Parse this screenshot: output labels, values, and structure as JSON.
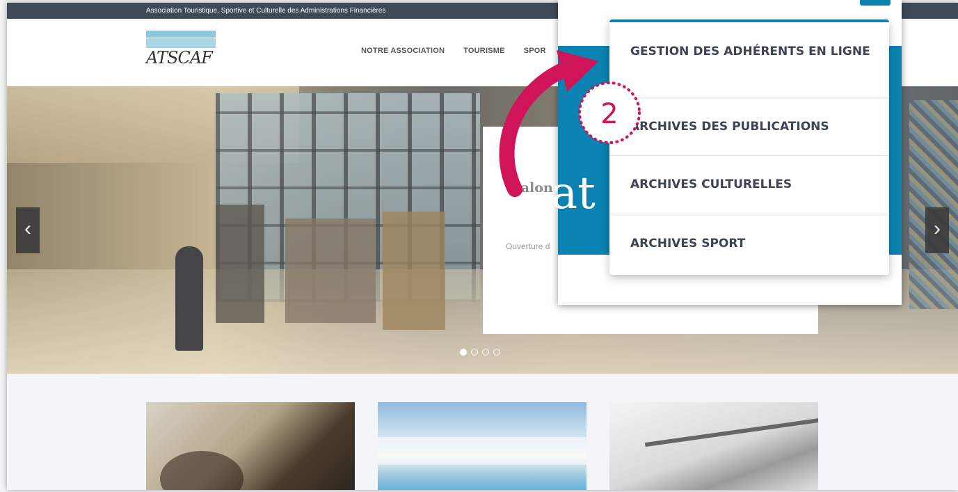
{
  "topbar": {
    "text": "Association Touristique, Sportive et Culturelle des Administrations Financières"
  },
  "logo": {
    "text": "ATSCAF"
  },
  "nav": {
    "items": [
      "NOTRE ASSOCIATION",
      "TOURISME",
      "SPOR"
    ]
  },
  "hero": {
    "caption_title": "Salon",
    "caption_text": "Ouverture d",
    "prev_icon": "chevron-left-icon",
    "next_icon": "chevron-right-icon",
    "dots": 4,
    "active_dot": 1
  },
  "zoom": {
    "serif_text": "at",
    "dropdown": [
      "GESTION DES ADHÉRENTS EN LIGNE",
      "ARCHIVES DES PUBLICATIONS",
      "ARCHIVES CULTURELLES",
      "ARCHIVES SPORT"
    ]
  },
  "annotation": {
    "step_number": "2",
    "color": "#d0145a"
  },
  "colors": {
    "accent": "#0b82b0",
    "topbar": "#3f4a56"
  }
}
